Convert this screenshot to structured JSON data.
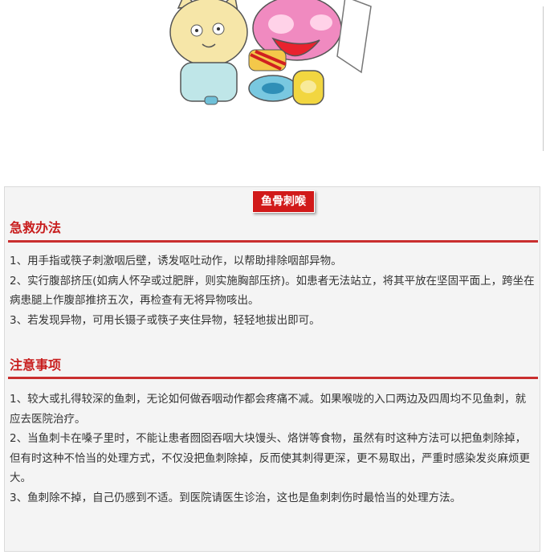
{
  "badge_title": "鱼骨刺喉",
  "sections": [
    {
      "title": "急救办法",
      "items": [
        "1、用手指或筷子刺激咽后壁，诱发呕吐动作，以帮助排除咽部异物。",
        "2、实行腹部挤压(如病人怀孕或过肥胖，则实施胸部压挤)。如患者无法站立，将其平放在坚固平面上，跨坐在病患腿上作腹部推挤五次，再检查有无将异物咳出。",
        "3、若发现异物，可用长镊子或筷子夹住异物，轻轻地拔出即可。"
      ]
    },
    {
      "title": "注意事项",
      "items": [
        "1、较大或扎得较深的鱼刺，无论如何做吞咽动作都会疼痛不减。如果喉咙的入口两边及四周均不见鱼刺，就应去医院治疗。",
        "2、当鱼刺卡在嗓子里时，不能让患者囫囵吞咽大块馒头、烙饼等食物，虽然有时这种方法可以把鱼刺除掉，但有时这种不恰当的处理方式，不仅没把鱼刺除掉，反而使其刺得更深，更不易取出，严重时感染发炎麻烦更大。",
        "3、鱼刺除不掉，自己仍感到不适。到医院请医生诊治，这也是鱼刺刺伤时最恰当的处理方法。"
      ]
    }
  ],
  "colors": {
    "accent": "#c81e1e",
    "badge": "#d11a1a",
    "card_bg": "#f4f4f4",
    "text": "#333333"
  }
}
